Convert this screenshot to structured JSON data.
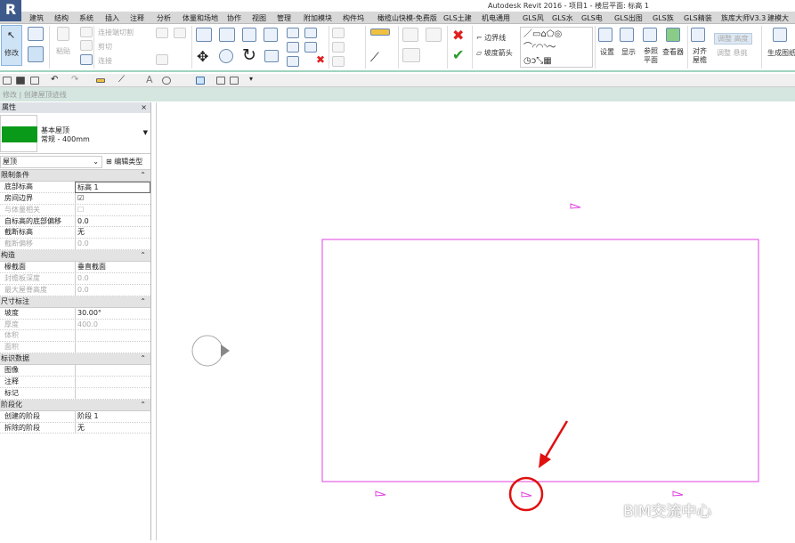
{
  "app": {
    "title": "Autodesk Revit 2016 -    项目1 - 楼层平面: 标高 1",
    "logo": "R"
  },
  "tabs": [
    "建筑",
    "结构",
    "系统",
    "插入",
    "注释",
    "分析",
    "体量和场地",
    "协作",
    "视图",
    "管理",
    "附加模块",
    "构件坞",
    "橄榄山快模-免费版",
    "GLS土建",
    "机电通用",
    "GLS风",
    "GLS水",
    "GLS电",
    "GLS出图",
    "GLS族",
    "GLS精装",
    "族库大师V3.3",
    "建模大"
  ],
  "ribbon": {
    "modify": "修改",
    "paste": "粘贴",
    "join_cut": "连接端切割",
    "cut": "剪切",
    "join": "连接",
    "boundary_line": "边界线",
    "slope_arrow": "坡度箭头",
    "set": "设置",
    "show": "显示",
    "ref_plane": "参照平面",
    "viewer": "查看器",
    "align_eave": "对齐屋檐",
    "adjust_height": "调整 高度",
    "adjust_overhang": "调整 悬挑",
    "generate": "生成图纸",
    "cancel_icon": "close-icon",
    "finish_icon": "check-icon"
  },
  "options_bar": "修改 | 创建屋顶迹线",
  "properties": {
    "title": "属性",
    "close": "×",
    "type_name": "基本屋顶",
    "type_sub": "常规 - 400mm",
    "swatch_color": "#0a9a1a",
    "category": "屋顶",
    "edit_type": "编辑类型",
    "groups": [
      {
        "name": "限制条件",
        "rows": [
          {
            "k": "底部标高",
            "v": "标高 1",
            "boxed": true
          },
          {
            "k": "房间边界",
            "v": "☑"
          },
          {
            "k": "与体量相关",
            "v": "☐",
            "dim": true
          },
          {
            "k": "自标高的底部偏移",
            "v": "0.0"
          },
          {
            "k": "截断标高",
            "v": "无"
          },
          {
            "k": "截断偏移",
            "v": "0.0",
            "dim": true
          }
        ]
      },
      {
        "name": "构造",
        "rows": [
          {
            "k": "椽截面",
            "v": "垂直截面"
          },
          {
            "k": "封檐板深度",
            "v": "0.0",
            "dim": true
          },
          {
            "k": "最大屋脊高度",
            "v": "0.0",
            "dim": true
          }
        ]
      },
      {
        "name": "尺寸标注",
        "rows": [
          {
            "k": "坡度",
            "v": "30.00°"
          },
          {
            "k": "厚度",
            "v": "400.0",
            "dim": true
          },
          {
            "k": "体积",
            "v": "",
            "dim": true
          },
          {
            "k": "面积",
            "v": "",
            "dim": true
          }
        ]
      },
      {
        "name": "标识数据",
        "rows": [
          {
            "k": "图像",
            "v": ""
          },
          {
            "k": "注释",
            "v": ""
          },
          {
            "k": "标记",
            "v": ""
          }
        ]
      },
      {
        "name": "阶段化",
        "rows": [
          {
            "k": "创建的阶段",
            "v": "阶段 1"
          },
          {
            "k": "拆除的阶段",
            "v": "无"
          }
        ]
      }
    ]
  },
  "canvas": {
    "sketch_color": "#e040e0",
    "highlight_color": "#e01010"
  },
  "watermark": "BIM交流中心"
}
